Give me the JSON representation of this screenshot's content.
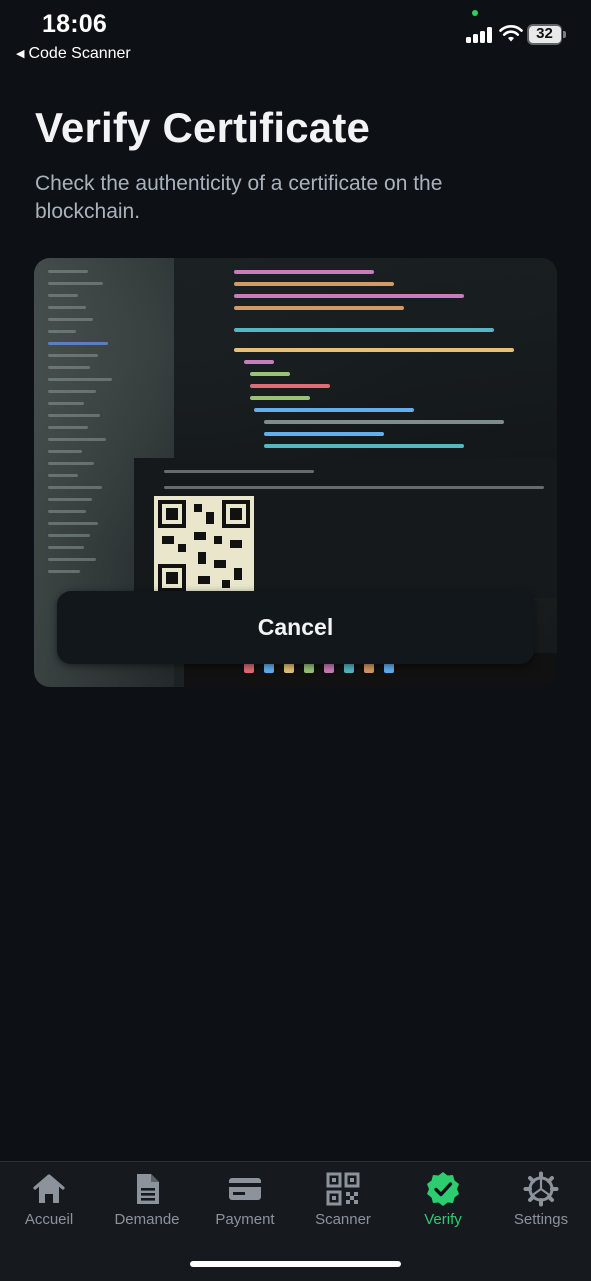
{
  "status_bar": {
    "time": "18:06",
    "back_label": "Code Scanner",
    "battery": "32"
  },
  "page": {
    "title": "Verify Certificate",
    "subtitle": "Check the authenticity of a certificate on the blockchain."
  },
  "scanner": {
    "cancel_label": "Cancel"
  },
  "tab_bar": {
    "active_color": "#2ecc71",
    "inactive_color": "#8c939b",
    "tabs": [
      {
        "label": "Accueil",
        "icon": "home-icon"
      },
      {
        "label": "Demande",
        "icon": "document-icon"
      },
      {
        "label": "Payment",
        "icon": "credit-card-icon"
      },
      {
        "label": "Scanner",
        "icon": "qr-code-icon"
      },
      {
        "label": "Verify",
        "icon": "verified-badge-icon",
        "active": true
      },
      {
        "label": "Settings",
        "icon": "gear-icon"
      }
    ]
  }
}
